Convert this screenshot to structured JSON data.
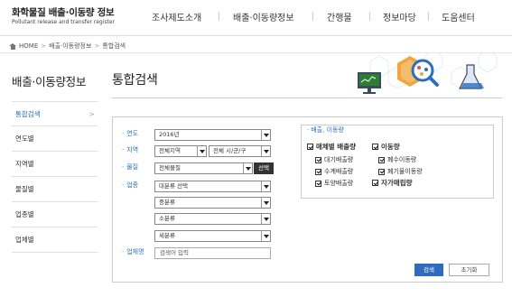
{
  "header": {
    "logo_title": "화학물질 배출·이동량 정보",
    "logo_subtitle": "Pollutant release and transfer register",
    "nav": [
      "조사제도소개",
      "배출·이동량정보",
      "간행물",
      "정보마당",
      "도움센터"
    ]
  },
  "breadcrumb": [
    "HOME",
    "배출·이동량정보",
    "통합검색"
  ],
  "sidebar": {
    "title": "배출·이동량정보",
    "items": [
      {
        "label": "통합검색",
        "active": true
      },
      {
        "label": "연도별",
        "active": false
      },
      {
        "label": "지역별",
        "active": false
      },
      {
        "label": "물질별",
        "active": false
      },
      {
        "label": "업종별",
        "active": false
      },
      {
        "label": "업체별",
        "active": false
      }
    ]
  },
  "main": {
    "title": "통합검색"
  },
  "form": {
    "year_label": "연도",
    "year_value": "2016년",
    "region_label": "지역",
    "region_value": "전체지역",
    "city_value": "전체 시/군/구",
    "substance_label": "물질",
    "substance_value": "전체물질",
    "select_button": "선택",
    "industry_label": "업종",
    "industry_major": "대분류 선택",
    "industry_mid": "중분류",
    "industry_small": "소분류",
    "industry_detail": "세분류",
    "company_label": "업체명",
    "company_placeholder": "검색어 입력"
  },
  "emission": {
    "title": "배출, 이동량",
    "release_total": "매체별 배출량",
    "transfer_total": "이동량",
    "air": "대기배출량",
    "water": "수계배출량",
    "soil": "토양배출량",
    "wastewater": "폐수이동량",
    "waste": "폐기물이동량",
    "self_landfill": "자가매립량"
  },
  "buttons": {
    "search": "검색",
    "reset": "초기화"
  },
  "colors": {
    "accent": "#2a6fbf",
    "search_button": "#2f6cc0"
  }
}
